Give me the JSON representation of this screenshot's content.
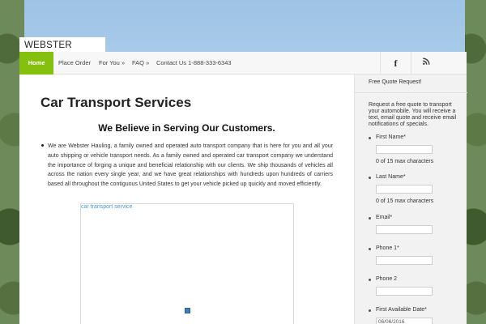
{
  "site": {
    "title": "WEBSTER HAULING"
  },
  "nav": {
    "items": [
      {
        "label": "Home"
      },
      {
        "label": "Place Order"
      },
      {
        "label": "For You »"
      },
      {
        "label": "FAQ »"
      },
      {
        "label": "Contact Us 1-888-333-6343"
      }
    ],
    "social": {
      "facebook": "f",
      "rss": "ʖ"
    }
  },
  "main": {
    "title": "Car Transport Services",
    "heading": "We Believe in Serving Our Customers.",
    "paragraph": "We are Webster Hauling, a family owned and operated auto transport company that is here for you and all your auto shipping or vehicle transport needs. As a family owned and operated car transport company we understand the importance of forging a unique and beneficial relationship with our clients. We ship thousands of vehicles all across the nation every single year, and we have great relationships with hundreds upon hundreds of carriers based all throughout the contiguous United States to get your vehicle picked up quickly and moved efficiently.",
    "image_alt": "car transport service"
  },
  "sidebar": {
    "title": "Free Quote Request!",
    "intro": "Request a free quote to transport your automobile. You will receive a text, email quote and receive email notifications of specials.",
    "fields": [
      {
        "label": "First Name*",
        "value": "",
        "counter": "0 of 15 max characters"
      },
      {
        "label": "Last Name*",
        "value": "",
        "counter": "0 of 15 max characters"
      },
      {
        "label": "Email*",
        "value": ""
      },
      {
        "label": "Phone 1*",
        "value": ""
      },
      {
        "label": "Phone 2",
        "value": ""
      },
      {
        "label": "First Available Date*",
        "value": "06/06/2016"
      }
    ]
  },
  "colors": {
    "accent": "#86c00f",
    "link": "#4a9ad6"
  }
}
